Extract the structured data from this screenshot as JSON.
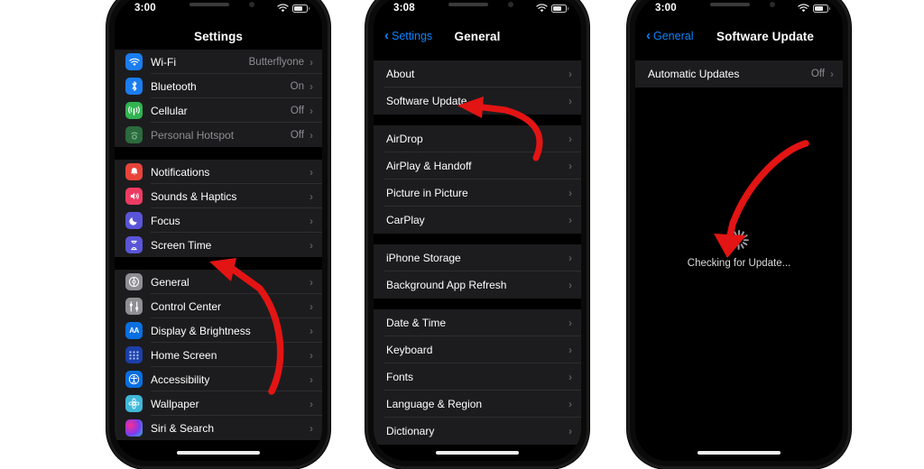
{
  "meta": {
    "accent_blue": "#0a84ff",
    "arrow_red": "#e31414",
    "list_bg": "#1c1c1e",
    "screen_bg": "#000000"
  },
  "phones": [
    {
      "id": "phone-settings",
      "status": {
        "time": "3:00",
        "wifi_icon": "wifi-icon",
        "battery_icon": "battery-icon"
      },
      "nav": {
        "title": "Settings",
        "back_label": null
      },
      "groups": [
        {
          "rows": [
            {
              "label": "Wi-Fi",
              "value": "Butterflyone",
              "icon": "wifi-icon",
              "icon_class": "ic-wifi",
              "glyph": "◔",
              "dim": false
            },
            {
              "label": "Bluetooth",
              "value": "On",
              "icon": "bluetooth-icon",
              "icon_class": "ic-bt",
              "glyph": "ᛘ",
              "dim": false
            },
            {
              "label": "Cellular",
              "value": "Off",
              "icon": "cellular-icon",
              "icon_class": "ic-cell",
              "glyph": "ॱ",
              "dim": false
            },
            {
              "label": "Personal Hotspot",
              "value": "Off",
              "icon": "hotspot-icon",
              "icon_class": "ic-hotspot",
              "glyph": "⚭",
              "dim": true
            }
          ]
        },
        {
          "rows": [
            {
              "label": "Notifications",
              "value": "",
              "icon": "notifications-icon",
              "icon_class": "ic-notif",
              "glyph": "🔔",
              "dim": false
            },
            {
              "label": "Sounds & Haptics",
              "value": "",
              "icon": "sounds-icon",
              "icon_class": "ic-sound",
              "glyph": "🔊",
              "dim": false
            },
            {
              "label": "Focus",
              "value": "",
              "icon": "focus-icon",
              "icon_class": "ic-focus",
              "glyph": "☾",
              "dim": false
            },
            {
              "label": "Screen Time",
              "value": "",
              "icon": "screen-time-icon",
              "icon_class": "ic-screen",
              "glyph": "⌛",
              "dim": false
            }
          ]
        },
        {
          "rows": [
            {
              "label": "General",
              "value": "",
              "icon": "general-gear-icon",
              "icon_class": "ic-general",
              "glyph": "⚙",
              "dim": false
            },
            {
              "label": "Control Center",
              "value": "",
              "icon": "control-center-icon",
              "icon_class": "ic-control",
              "glyph": "☰",
              "dim": false
            },
            {
              "label": "Display & Brightness",
              "value": "",
              "icon": "display-brightness-icon",
              "icon_class": "ic-display",
              "glyph": "AA",
              "dim": false
            },
            {
              "label": "Home Screen",
              "value": "",
              "icon": "home-screen-icon",
              "icon_class": "ic-home",
              "glyph": "☷",
              "dim": false
            },
            {
              "label": "Accessibility",
              "value": "",
              "icon": "accessibility-icon",
              "icon_class": "ic-access",
              "glyph": "⛿",
              "dim": false
            },
            {
              "label": "Wallpaper",
              "value": "",
              "icon": "wallpaper-icon",
              "icon_class": "ic-wall",
              "glyph": "❁",
              "dim": false
            },
            {
              "label": "Siri & Search",
              "value": "",
              "icon": "siri-icon",
              "icon_class": "ic-siri",
              "glyph": "",
              "dim": false
            }
          ]
        }
      ]
    },
    {
      "id": "phone-general",
      "status": {
        "time": "3:08",
        "wifi_icon": "wifi-icon",
        "battery_icon": "battery-icon"
      },
      "nav": {
        "title": "General",
        "back_label": "Settings"
      },
      "groups": [
        {
          "rows": [
            {
              "label": "About",
              "value": ""
            },
            {
              "label": "Software Update",
              "value": ""
            }
          ]
        },
        {
          "rows": [
            {
              "label": "AirDrop",
              "value": ""
            },
            {
              "label": "AirPlay & Handoff",
              "value": ""
            },
            {
              "label": "Picture in Picture",
              "value": ""
            },
            {
              "label": "CarPlay",
              "value": ""
            }
          ]
        },
        {
          "rows": [
            {
              "label": "iPhone Storage",
              "value": ""
            },
            {
              "label": "Background App Refresh",
              "value": ""
            }
          ]
        },
        {
          "rows": [
            {
              "label": "Date & Time",
              "value": ""
            },
            {
              "label": "Keyboard",
              "value": ""
            },
            {
              "label": "Fonts",
              "value": ""
            },
            {
              "label": "Language & Region",
              "value": ""
            },
            {
              "label": "Dictionary",
              "value": ""
            }
          ]
        }
      ]
    },
    {
      "id": "phone-software-update",
      "status": {
        "time": "3:00",
        "wifi_icon": "wifi-icon",
        "battery_icon": "battery-icon"
      },
      "nav": {
        "title": "Software Update",
        "back_label": "General"
      },
      "groups": [
        {
          "rows": [
            {
              "label": "Automatic Updates",
              "value": "Off"
            }
          ]
        }
      ],
      "checking": {
        "text": "Checking for Update...",
        "spinner": "activity-spinner-icon"
      }
    }
  ],
  "annotations": [
    {
      "name": "arrow-to-general",
      "target": "General"
    },
    {
      "name": "arrow-to-software-update",
      "target": "Software Update"
    },
    {
      "name": "arrow-to-checking-for-update",
      "target": "Checking for Update..."
    }
  ]
}
